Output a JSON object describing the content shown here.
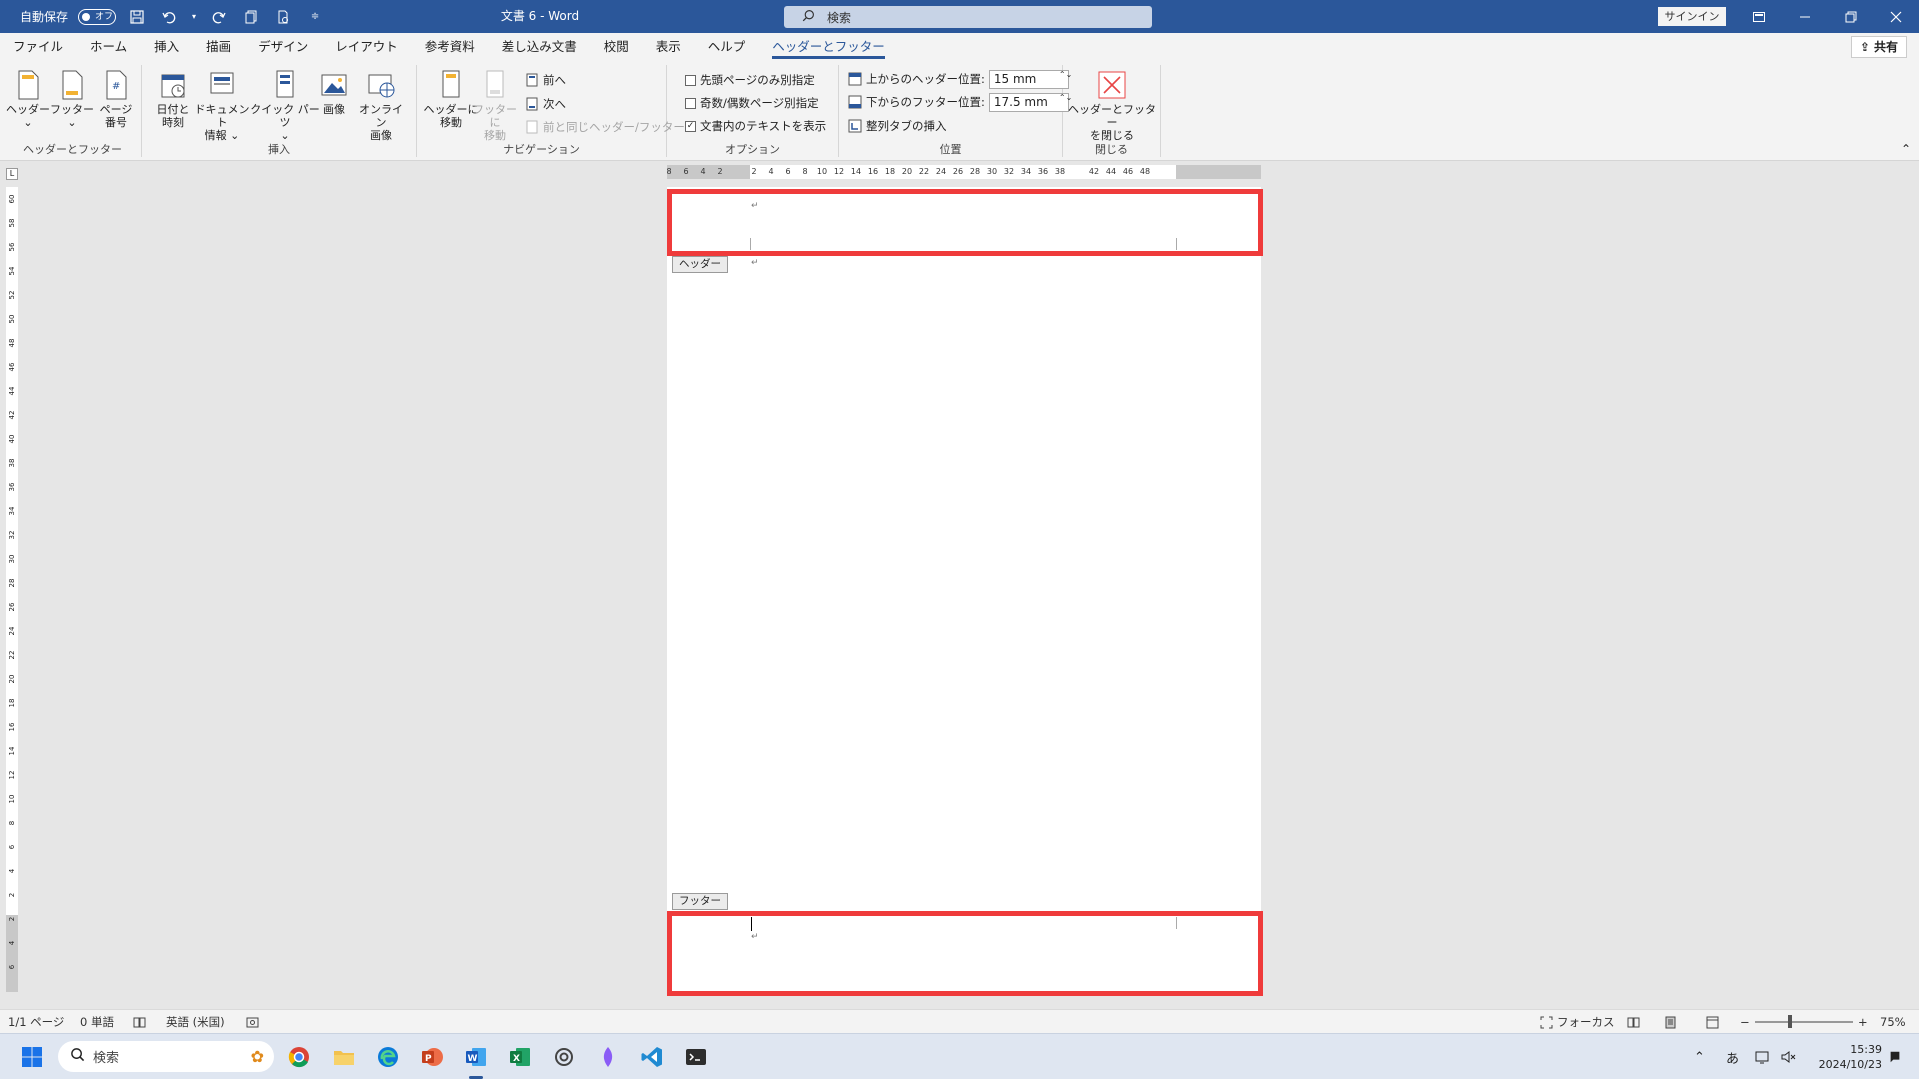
{
  "titlebar": {
    "autosave_label": "自動保存",
    "autosave_state": "オフ",
    "doc_title": "文書 6 - Word",
    "search_placeholder": "検索",
    "signin": "サインイン"
  },
  "tabs": [
    "ファイル",
    "ホーム",
    "挿入",
    "描画",
    "デザイン",
    "レイアウト",
    "参考資料",
    "差し込み文書",
    "校閲",
    "表示",
    "ヘルプ",
    "ヘッダーとフッター"
  ],
  "active_tab": "ヘッダーとフッター",
  "share_label": "共有",
  "ribbon": {
    "hf_group": {
      "label": "ヘッダーとフッター",
      "header_btn": "ヘッダー",
      "footer_btn": "フッター",
      "page_number_btn": [
        "ページ",
        "番号"
      ]
    },
    "insert_group": {
      "label": "挿入",
      "datetime_btn": [
        "日付と",
        "時刻"
      ],
      "docinfo_btn": [
        "ドキュメント",
        "情報"
      ],
      "quickparts_btn": "クイック パーツ",
      "image_btn": "画像",
      "online_image_btn": [
        "オンライン",
        "画像"
      ]
    },
    "nav_group": {
      "label": "ナビゲーション",
      "goto_header_btn": [
        "ヘッダーに",
        "移動"
      ],
      "goto_footer_btn": [
        "フッターに",
        "移動"
      ],
      "prev_btn": "前へ",
      "next_btn": "次へ",
      "link_prev_btn": "前と同じヘッダー/フッター"
    },
    "options_group": {
      "label": "オプション",
      "first_page": "先頭ページのみ別指定",
      "odd_even": "奇数/偶数ページ別指定",
      "show_text": "文書内のテキストを表示",
      "show_text_checked": "✓"
    },
    "position_group": {
      "label": "位置",
      "header_pos_label": "上からのヘッダー位置:",
      "header_pos_value": "15 mm",
      "footer_pos_label": "下からのフッター位置:",
      "footer_pos_value": "17.5 mm",
      "align_tab_btn": "整列タブの挿入"
    },
    "close_group": {
      "label": "閉じる",
      "close_btn": [
        "ヘッダーとフッター",
        "を閉じる"
      ]
    }
  },
  "ruler": {
    "corner": "L",
    "h_numbers": [
      "8",
      "6",
      "4",
      "2",
      "2",
      "4",
      "6",
      "8",
      "10",
      "12",
      "14",
      "16",
      "18",
      "20",
      "22",
      "24",
      "26",
      "28",
      "30",
      "32",
      "34",
      "36",
      "38",
      "42",
      "44",
      "46",
      "48"
    ],
    "v_numbers": [
      "60",
      "58",
      "56",
      "54",
      "52",
      "50",
      "48",
      "46",
      "44",
      "42",
      "40",
      "38",
      "36",
      "34",
      "32",
      "30",
      "28",
      "26",
      "24",
      "22",
      "20",
      "18",
      "16",
      "14",
      "12",
      "10",
      "8",
      "6",
      "4",
      "2",
      "2",
      "4",
      "6"
    ]
  },
  "page": {
    "header_tag": "ヘッダー",
    "footer_tag": "フッター",
    "para_mark": "↵"
  },
  "statusbar": {
    "page": "1/1 ページ",
    "words": "0 単語",
    "language": "英語 (米国)",
    "focus": "フォーカス",
    "zoom_minus": "−",
    "zoom_plus": "+",
    "zoom": "75%"
  },
  "taskbar": {
    "search_placeholder": "検索",
    "ime": "あ",
    "time": "15:39",
    "date": "2024/10/23"
  },
  "colors": {
    "accent": "#2b579a",
    "highlight_box": "#ef3b3b"
  }
}
